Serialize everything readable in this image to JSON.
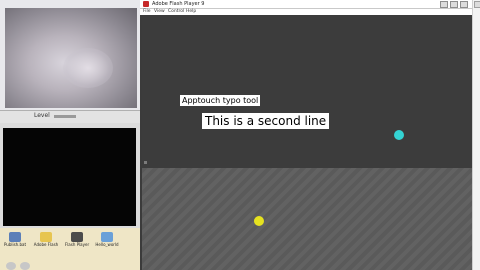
{
  "player": {
    "title": "Adobe Flash Player 9",
    "menu": [
      "File",
      "View",
      "Control",
      "Help"
    ]
  },
  "stage": {
    "label_small": "Apptouch typo tool",
    "label_large": "This is a second line",
    "dot_colors": {
      "cyan": "#34d3d3",
      "yellow": "#e6e21f"
    }
  },
  "camera_panel": {
    "slider_label": "Level"
  },
  "desktop": {
    "icons": [
      {
        "name": "folder-icon",
        "label": "Publish.bat",
        "color": "#5c7fb8"
      },
      {
        "name": "folder-icon",
        "label": "Adobe Flash",
        "color": "#e7c550"
      },
      {
        "name": "app-icon",
        "label": "Flash Player",
        "color": "#4c4c4c"
      },
      {
        "name": "app-icon",
        "label": "Hello_world",
        "color": "#6aa0d8"
      }
    ]
  }
}
